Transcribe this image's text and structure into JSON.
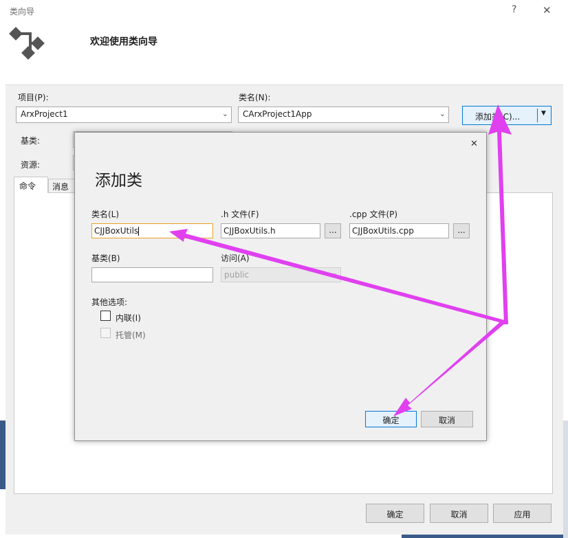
{
  "wizard": {
    "title": "类向导",
    "help": "?",
    "close": "✕",
    "welcome": "欢迎使用类向导",
    "project_label": "项目(P):",
    "project_value": "ArxProject1",
    "classname_label": "类名(N):",
    "classname_value": "CArxProject1App",
    "add_class_button": "添加类(C)...",
    "base_label": "基类:",
    "resource_label": "资源:",
    "tab_commands": "命令",
    "tab_messages": "消息",
    "ok_button": "确定",
    "cancel_button": "取消",
    "apply_button": "应用"
  },
  "dialog": {
    "close": "✕",
    "title": "添加类",
    "classname_label": "类名(L)",
    "classname_value": "CJJBoxUtils",
    "h_file_label": ".h 文件(F)",
    "h_file_value": "CJJBoxUtils.h",
    "cpp_file_label": ".cpp 文件(P)",
    "cpp_file_value": "CJJBoxUtils.cpp",
    "browse": "...",
    "base_label": "基类(B)",
    "base_value": "",
    "access_label": "访问(A)",
    "access_value": "public",
    "other_options_label": "其他选项:",
    "inline_label": "内联(I)",
    "managed_label": "托管(M)",
    "ok_button": "确定",
    "cancel_button": "取消"
  },
  "colors": {
    "annotation_arrow": "#e040f0",
    "focus_border": "#0078d7"
  }
}
